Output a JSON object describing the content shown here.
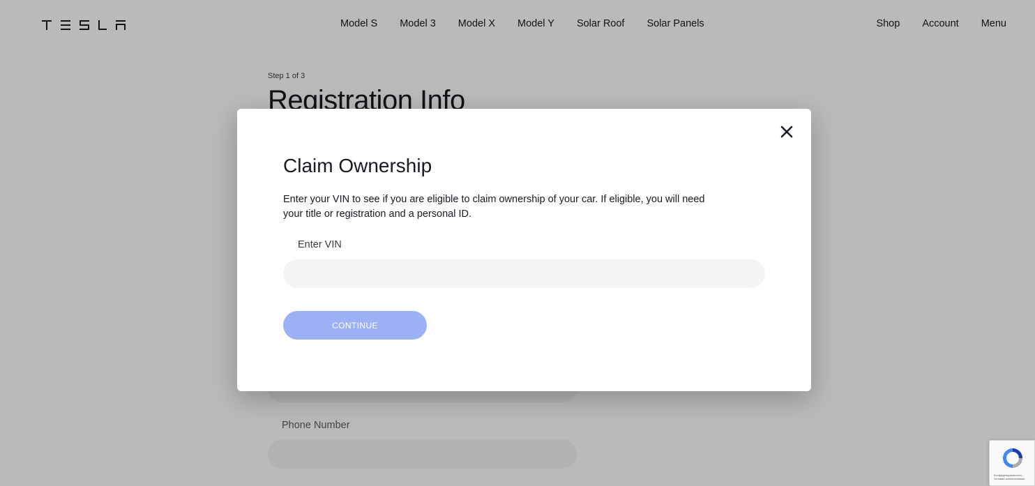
{
  "header": {
    "logo_alt": "TESLA",
    "nav_center": [
      "Model S",
      "Model 3",
      "Model X",
      "Model Y",
      "Solar Roof",
      "Solar Panels"
    ],
    "nav_right": [
      "Shop",
      "Account",
      "Menu"
    ]
  },
  "page": {
    "step": "Step 1 of 3",
    "title": "Registration Info",
    "phone_label": "Phone Number"
  },
  "modal": {
    "title": "Claim Ownership",
    "description": "Enter your VIN to see if you are eligible to claim ownership of your car. If eligible, you will need your title or registration and a personal ID.",
    "vin_label": "Enter VIN",
    "vin_value": "",
    "continue_label": "CONTINUE",
    "close_icon": "close-icon"
  },
  "recaptcha": {
    "text_line1": "Конфиденциальность -",
    "text_line2": "Условия использования"
  },
  "colors": {
    "continue_button": "#9cb1f3",
    "input_bg": "#f4f4f4",
    "text": "#171a20"
  }
}
